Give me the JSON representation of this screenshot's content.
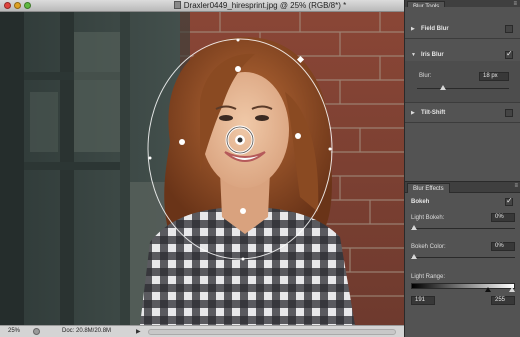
{
  "window": {
    "title": "Draxler0449_hiresprint.jpg @ 25% (RGB/8*) *"
  },
  "status_bar": {
    "zoom": "25%",
    "doc_info": "Doc: 20.8M/20.8M"
  },
  "blur_tools_panel": {
    "tab_label": "Blur Tools",
    "items": [
      {
        "label": "Field Blur",
        "expanded": false,
        "enabled": false
      },
      {
        "label": "Iris Blur",
        "expanded": true,
        "enabled": true
      },
      {
        "label": "Tilt-Shift",
        "expanded": false,
        "enabled": false
      }
    ],
    "iris_blur": {
      "blur_label": "Blur:",
      "blur_value": "18 px",
      "blur_level": 0.28
    }
  },
  "blur_effects_panel": {
    "tab_label": "Blur Effects",
    "bokeh_label": "Bokeh",
    "bokeh_enabled": true,
    "light_bokeh_label": "Light Bokeh:",
    "light_bokeh_value": "0%",
    "bokeh_color_label": "Bokeh Color:",
    "bokeh_color_value": "0%",
    "light_range_label": "Light Range:",
    "light_range_min": "191",
    "light_range_max": "255"
  }
}
